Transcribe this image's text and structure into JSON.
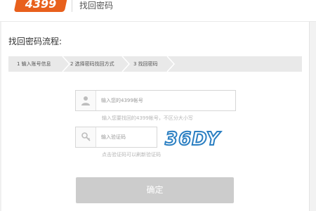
{
  "header": {
    "logo_text": "4399",
    "title": "找回密码",
    "brand_color": "#e8601c"
  },
  "section": {
    "title": "找回密码流程:"
  },
  "steps": [
    {
      "label": "1 输入账号信息"
    },
    {
      "label": "2 选择密码找回方式"
    },
    {
      "label": "3 找回密码"
    }
  ],
  "form": {
    "account": {
      "placeholder": "输入您的4399帐号",
      "hint": "输入您要找回的4399帐号，不区分大小写",
      "icon": "user-icon"
    },
    "captcha": {
      "placeholder": "输入验证码",
      "hint": "点击验证码可以刷新验证码",
      "icon": "key-icon",
      "code_text": "36DY"
    },
    "confirm_label": "确定"
  }
}
